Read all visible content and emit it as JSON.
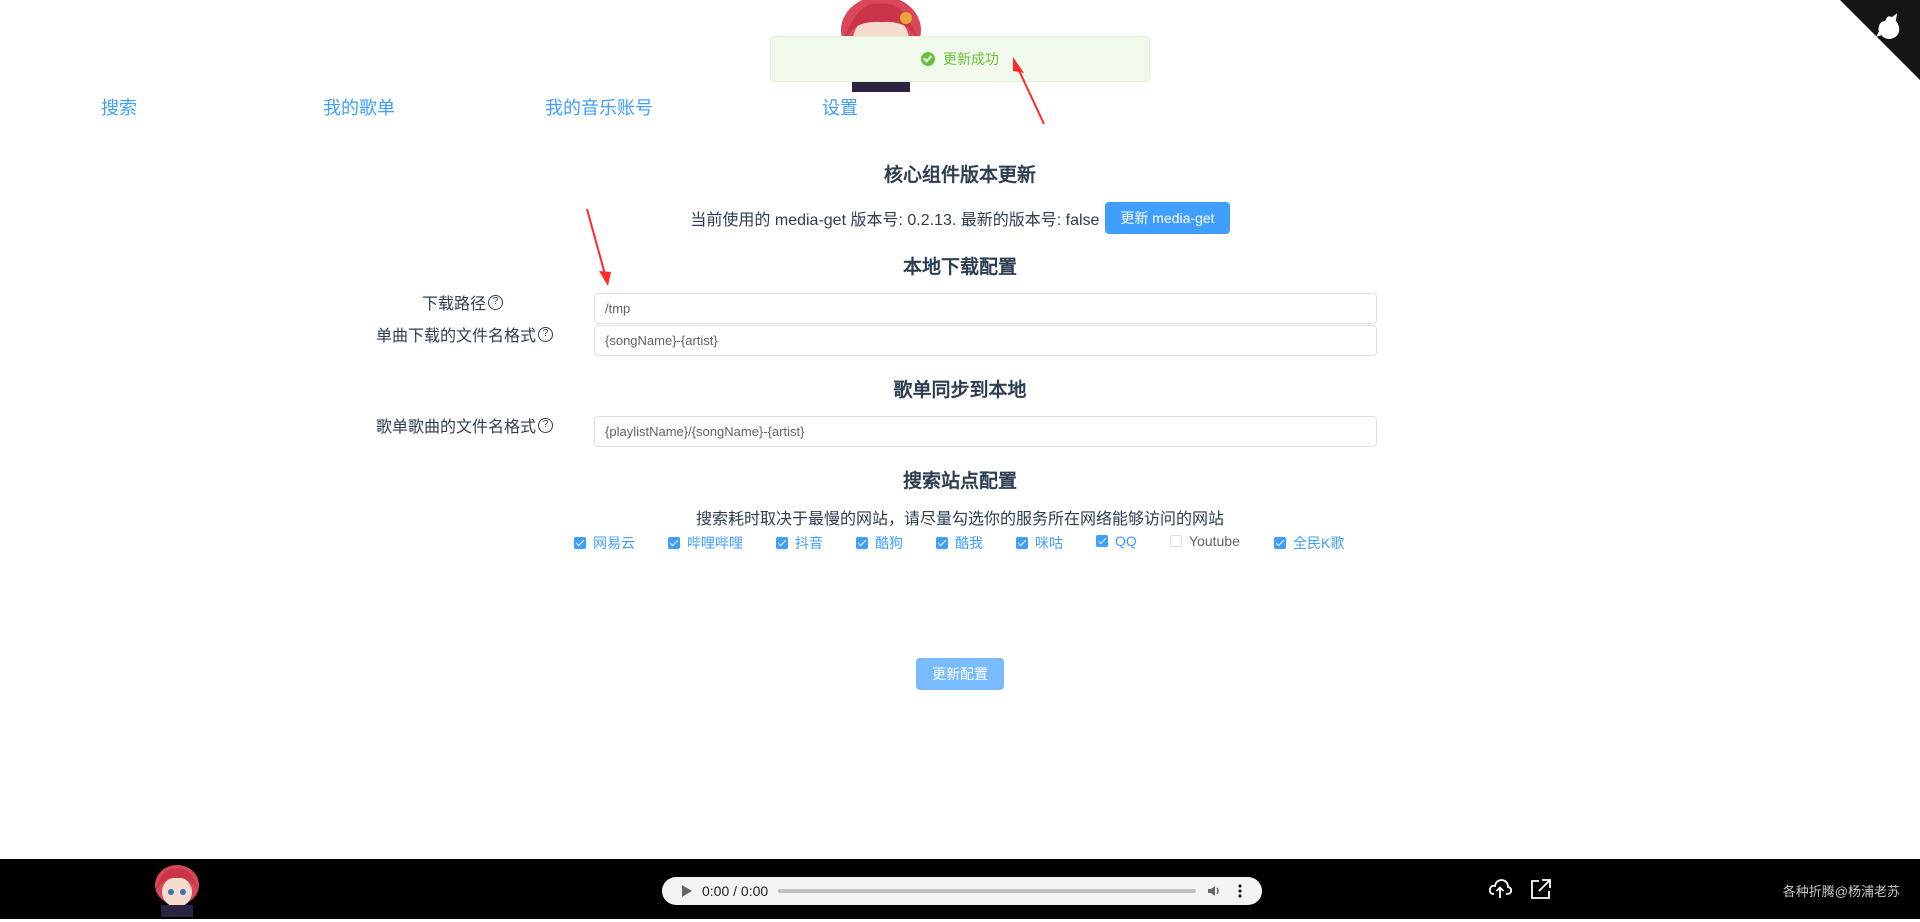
{
  "toast": {
    "message": "更新成功",
    "icon": "check-circle-icon",
    "color": "#67c23a"
  },
  "nav": {
    "items": [
      {
        "label": "搜索"
      },
      {
        "label": "我的歌单"
      },
      {
        "label": "我的音乐账号"
      },
      {
        "label": "设置"
      }
    ]
  },
  "core": {
    "title": "核心组件版本更新",
    "version_text": "当前使用的 media-get 版本号: 0.2.13. 最新的版本号: false",
    "update_button": "更新 media-get"
  },
  "local": {
    "title": "本地下载配置",
    "path_label": "下载路径",
    "path_value": "/tmp",
    "filename_label": "单曲下载的文件名格式",
    "filename_value": "{songName}-{artist}"
  },
  "playlist_sync": {
    "title": "歌单同步到本地",
    "filename_label": "歌单歌曲的文件名格式",
    "filename_value": "{playlistName}/{songName}-{artist}"
  },
  "sites": {
    "title": "搜索站点配置",
    "tip": "搜索耗时取决于最慢的网站，请尽量勾选你的服务所在网络能够访问的网站",
    "items": [
      {
        "label": "网易云",
        "checked": true
      },
      {
        "label": "哔哩哔哩",
        "checked": true
      },
      {
        "label": "抖音",
        "checked": true
      },
      {
        "label": "酷狗",
        "checked": true
      },
      {
        "label": "酷我",
        "checked": true
      },
      {
        "label": "咪咕",
        "checked": true
      },
      {
        "label": "QQ",
        "checked": true
      },
      {
        "label": "Youtube",
        "checked": false
      },
      {
        "label": "全民K歌",
        "checked": true
      }
    ]
  },
  "save_button": "更新配置",
  "footer": {
    "time": "0:00 / 0:00",
    "credit": "各种折腾@杨浦老苏",
    "icons": [
      "cloud-upload-icon",
      "external-link-icon"
    ]
  },
  "colors": {
    "accent": "#409eff",
    "accent_light": "#79bbff",
    "success": "#67c23a",
    "annotation": "#ff2a2a"
  }
}
